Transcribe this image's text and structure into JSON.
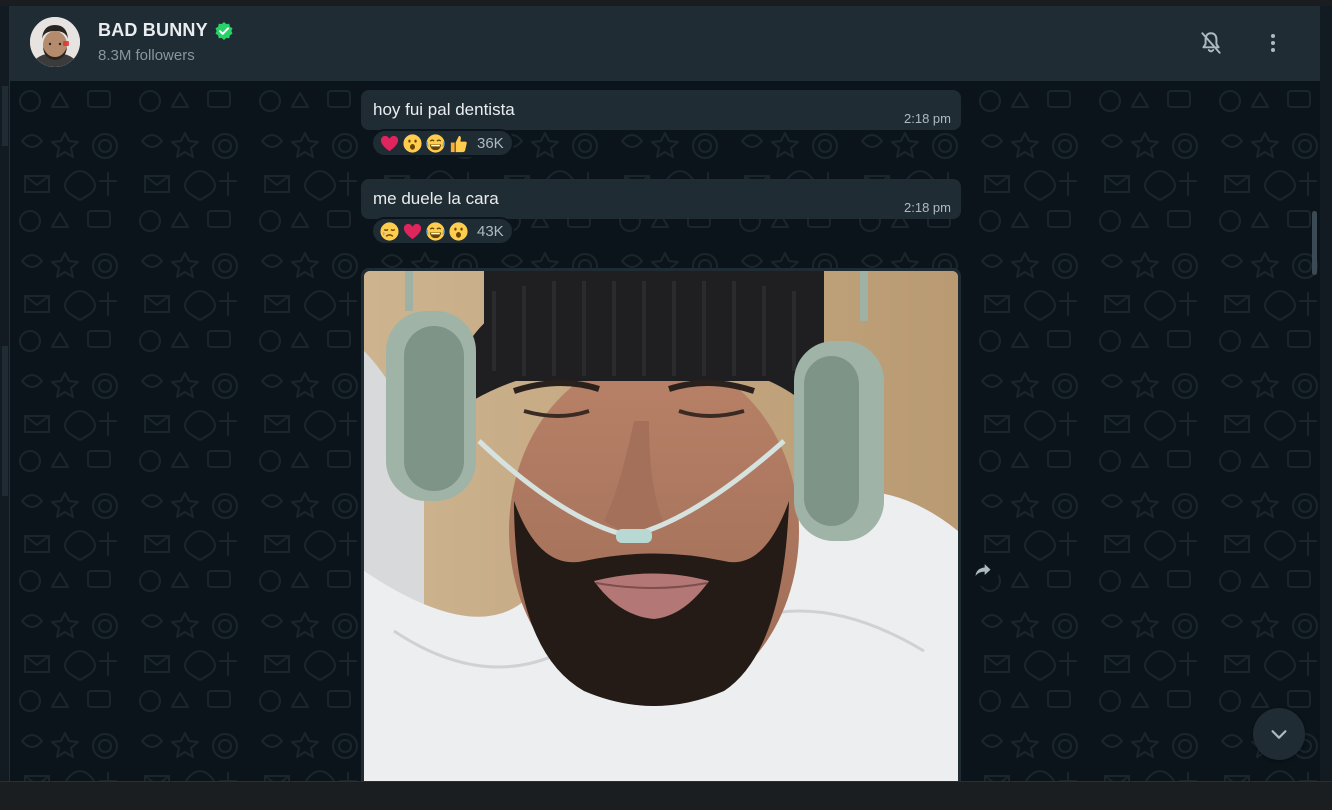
{
  "channel": {
    "name": "BAD BUNNY",
    "followers": "8.3M followers",
    "verified_icon": "verified-badge-icon",
    "accent_color": "#25d366"
  },
  "header_actions": {
    "mute_icon": "bell-off-icon",
    "menu_icon": "more-vertical-icon"
  },
  "messages": [
    {
      "text": "hoy fui pal dentista",
      "time": "2:18 pm",
      "reactions": [
        "heart",
        "open-mouth-face",
        "laughing-face",
        "thumbs-up"
      ],
      "reaction_count": "36K"
    },
    {
      "text": "me duele la cara",
      "time": "2:18 pm",
      "reactions": [
        "sad-tear-face",
        "heart",
        "laughing-face",
        "open-mouth-face"
      ],
      "reaction_count": "43K"
    }
  ],
  "media": {
    "type": "photo",
    "forward_icon": "forward-arrow-icon"
  },
  "scroll_down_icon": "chevron-down-icon",
  "colors": {
    "header_bg": "#202c33",
    "chat_bg": "#0b141a",
    "bubble_bg": "#202c33",
    "text": "#e9edef",
    "muted": "#8696a0"
  }
}
